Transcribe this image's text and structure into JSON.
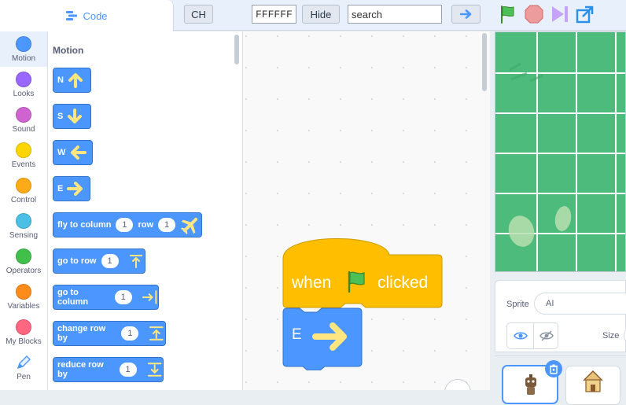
{
  "toolbar": {
    "code_tab": "Code",
    "ch_button": "CH",
    "color_value": "FFFFFF",
    "hide_button": "Hide",
    "search_placeholder": "search"
  },
  "categories": [
    {
      "label": "Motion",
      "color": "#4c97ff"
    },
    {
      "label": "Looks",
      "color": "#9966ff"
    },
    {
      "label": "Sound",
      "color": "#cf63cf"
    },
    {
      "label": "Events",
      "color": "#ffd500"
    },
    {
      "label": "Control",
      "color": "#ffab19"
    },
    {
      "label": "Sensing",
      "color": "#4cbfe6"
    },
    {
      "label": "Operators",
      "color": "#40bf4a"
    },
    {
      "label": "Variables",
      "color": "#ff8c1a"
    },
    {
      "label": "My Blocks",
      "color": "#ff6680"
    },
    {
      "label": "Pen",
      "color": "#0fbd8c"
    }
  ],
  "palette": {
    "heading": "Motion",
    "blocks": [
      {
        "label": "N",
        "icon": "arrow-up-icon"
      },
      {
        "label": "S",
        "icon": "arrow-down-icon"
      },
      {
        "label": "W",
        "icon": "arrow-left-icon"
      },
      {
        "label": "E",
        "icon": "arrow-right-icon"
      },
      {
        "label": "fly to column",
        "value1": "1",
        "label2": "row",
        "value2": "1",
        "icon": "airplane-icon"
      },
      {
        "label": "go to row",
        "value1": "1",
        "icon": "go-to-row-icon"
      },
      {
        "label": "go to column",
        "value1": "1",
        "icon": "go-to-column-icon"
      },
      {
        "label": "change row by",
        "value1": "1",
        "icon": "change-row-icon"
      },
      {
        "label": "reduce row by",
        "value1": "1",
        "icon": "reduce-row-icon"
      }
    ]
  },
  "script": {
    "hat_when": "when",
    "hat_clicked": "clicked",
    "move_label": "E"
  },
  "sprite": {
    "label": "Sprite",
    "name": "AI",
    "size_label": "Size"
  }
}
